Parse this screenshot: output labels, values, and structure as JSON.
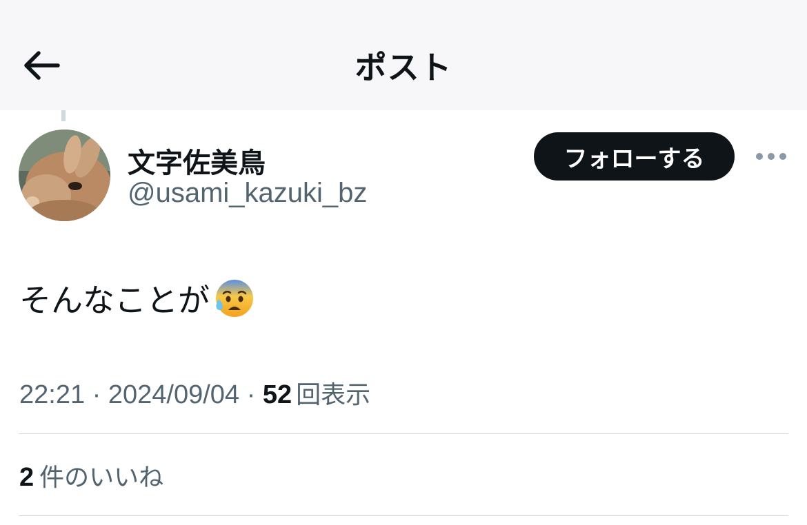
{
  "header": {
    "title": "ポスト",
    "back_icon": "arrow-left-icon"
  },
  "author": {
    "display_name": "文字佐美鳥",
    "handle": "@usami_kazuki_bz",
    "avatar_icon": "rabbit-avatar"
  },
  "actions": {
    "follow_label": "フォローする",
    "more_icon": "more-horizontal-icon"
  },
  "post": {
    "text": "そんなことが",
    "emoji_icon": "anxious-face-with-sweat-emoji"
  },
  "meta": {
    "time": "22:21",
    "separator": " · ",
    "date": "2024/09/04",
    "views_count": "52",
    "views_label": "回表示"
  },
  "stats": {
    "likes_count": "2",
    "likes_label": "件のいいね"
  },
  "colors": {
    "text_primary": "#0f1419",
    "text_secondary": "#536471",
    "divider": "#cfd9de",
    "follow_button_bg": "#0f1419",
    "header_bg": "#f7f7f9"
  }
}
